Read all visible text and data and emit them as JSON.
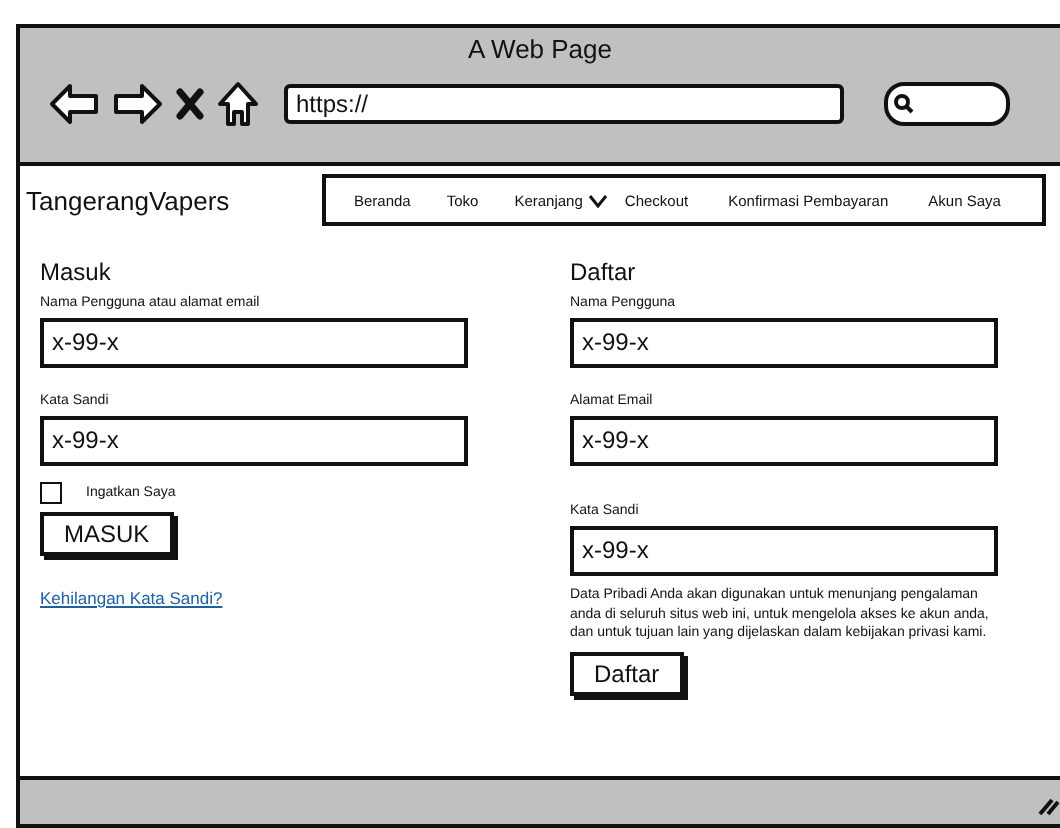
{
  "window": {
    "title": "A Web Page"
  },
  "toolbar": {
    "url": "https://"
  },
  "brand": "TangerangVapers",
  "nav": [
    {
      "label": "Beranda",
      "kind": "link"
    },
    {
      "label": "Toko",
      "kind": "link"
    },
    {
      "label": "Keranjang",
      "kind": "dropdown"
    },
    {
      "label": "Checkout",
      "kind": "link"
    },
    {
      "label": "Konfirmasi Pembayaran",
      "kind": "link"
    },
    {
      "label": "Akun Saya",
      "kind": "link"
    }
  ],
  "login": {
    "heading": "Masuk",
    "fields": [
      {
        "label": "Nama Pengguna atau alamat email",
        "value": "x-99-x"
      },
      {
        "label": "Kata Sandi",
        "value": "x-99-x"
      }
    ],
    "remember": {
      "label": "Ingatkan Saya",
      "checked": false
    },
    "button": "MASUK",
    "link": "Kehilangan Kata Sandi?"
  },
  "register": {
    "heading": "Daftar",
    "fields": [
      {
        "label": "Nama Pengguna",
        "value": "x-99-x"
      },
      {
        "label": "Alamat Email",
        "value": "x-99-x"
      },
      {
        "label": "Kata Sandi",
        "value": "x-99-x"
      }
    ],
    "privacy": "Data Pribadi Anda akan digunakan untuk menunjang pengalaman anda di seluruh situs web ini, untuk mengelola akses ke akun anda, dan untuk tujuan lain yang dijelaskan dalam kebijakan privasi kami.",
    "button": "Daftar"
  }
}
